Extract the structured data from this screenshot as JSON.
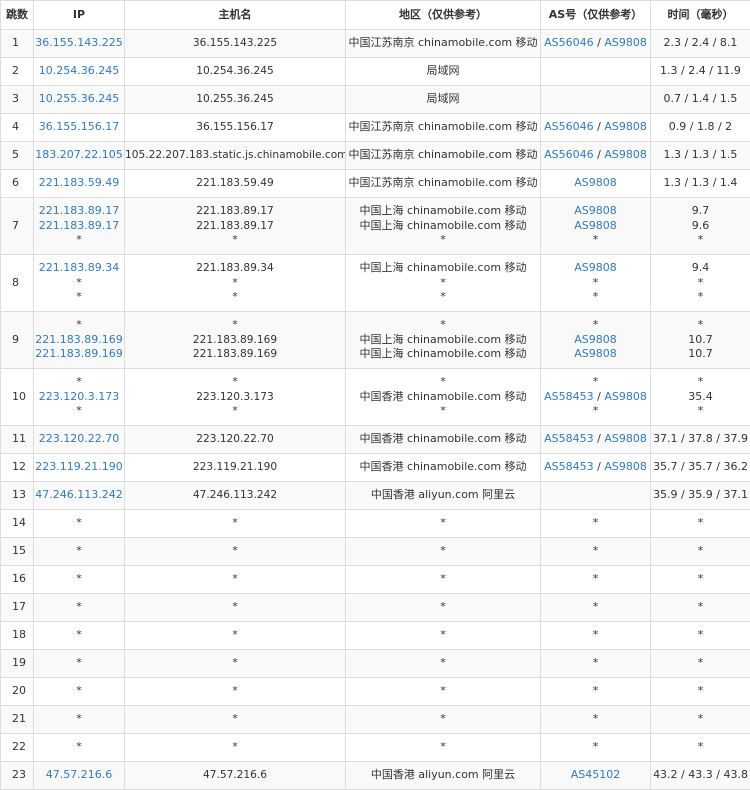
{
  "headers": {
    "hop": "跳数",
    "ip": "IP",
    "host": "主机名",
    "region": "地区（仅供参考）",
    "as": "AS号（仅供参考）",
    "time": "时间（毫秒）"
  },
  "rows": [
    {
      "hop": "1",
      "lines": [
        {
          "ip": "36.155.143.225",
          "host": "36.155.143.225",
          "region": "中国江苏南京 chinamobile.com 移动",
          "as": [
            "AS56046",
            "AS9808"
          ],
          "time": "2.3 / 2.4 / 8.1"
        }
      ]
    },
    {
      "hop": "2",
      "lines": [
        {
          "ip": "10.254.36.245",
          "host": "10.254.36.245",
          "region": "局域网",
          "as": [],
          "time": "1.3 / 2.4 / 11.9"
        }
      ]
    },
    {
      "hop": "3",
      "lines": [
        {
          "ip": "10.255.36.245",
          "host": "10.255.36.245",
          "region": "局域网",
          "as": [],
          "time": "0.7 / 1.4 / 1.5"
        }
      ]
    },
    {
      "hop": "4",
      "lines": [
        {
          "ip": "36.155.156.17",
          "host": "36.155.156.17",
          "region": "中国江苏南京 chinamobile.com 移动",
          "as": [
            "AS56046",
            "AS9808"
          ],
          "time": "0.9 / 1.8 / 2"
        }
      ]
    },
    {
      "hop": "5",
      "lines": [
        {
          "ip": "183.207.22.105",
          "host": "105.22.207.183.static.js.chinamobile.com",
          "region": "中国江苏南京 chinamobile.com 移动",
          "as": [
            "AS56046",
            "AS9808"
          ],
          "time": "1.3 / 1.3 / 1.5"
        }
      ]
    },
    {
      "hop": "6",
      "lines": [
        {
          "ip": "221.183.59.49",
          "host": "221.183.59.49",
          "region": "中国江苏南京 chinamobile.com 移动",
          "as": [
            "AS9808"
          ],
          "time": "1.3 / 1.3 / 1.4"
        }
      ]
    },
    {
      "hop": "7",
      "lines": [
        {
          "ip": "221.183.89.17",
          "host": "221.183.89.17",
          "region": "中国上海 chinamobile.com 移动",
          "as": [
            "AS9808"
          ],
          "time": "9.7"
        },
        {
          "ip": "221.183.89.17",
          "host": "221.183.89.17",
          "region": "中国上海 chinamobile.com 移动",
          "as": [
            "AS9808"
          ],
          "time": "9.6"
        },
        {
          "ip": "*",
          "host": "*",
          "region": "*",
          "as": [
            "*"
          ],
          "time": "*"
        }
      ]
    },
    {
      "hop": "8",
      "lines": [
        {
          "ip": "221.183.89.34",
          "host": "221.183.89.34",
          "region": "中国上海 chinamobile.com 移动",
          "as": [
            "AS9808"
          ],
          "time": "9.4"
        },
        {
          "ip": "*",
          "host": "*",
          "region": "*",
          "as": [
            "*"
          ],
          "time": "*"
        },
        {
          "ip": "*",
          "host": "*",
          "region": "*",
          "as": [
            "*"
          ],
          "time": "*"
        }
      ]
    },
    {
      "hop": "9",
      "lines": [
        {
          "ip": "*",
          "host": "*",
          "region": "*",
          "as": [
            "*"
          ],
          "time": "*"
        },
        {
          "ip": "221.183.89.169",
          "host": "221.183.89.169",
          "region": "中国上海 chinamobile.com 移动",
          "as": [
            "AS9808"
          ],
          "time": "10.7"
        },
        {
          "ip": "221.183.89.169",
          "host": "221.183.89.169",
          "region": "中国上海 chinamobile.com 移动",
          "as": [
            "AS9808"
          ],
          "time": "10.7"
        }
      ]
    },
    {
      "hop": "10",
      "lines": [
        {
          "ip": "*",
          "host": "*",
          "region": "*",
          "as": [
            "*"
          ],
          "time": "*"
        },
        {
          "ip": "223.120.3.173",
          "host": "223.120.3.173",
          "region": "中国香港 chinamobile.com 移动",
          "as": [
            "AS58453",
            "AS9808"
          ],
          "time": "35.4"
        },
        {
          "ip": "*",
          "host": "*",
          "region": "*",
          "as": [
            "*"
          ],
          "time": "*"
        }
      ]
    },
    {
      "hop": "11",
      "lines": [
        {
          "ip": "223.120.22.70",
          "host": "223.120.22.70",
          "region": "中国香港 chinamobile.com 移动",
          "as": [
            "AS58453",
            "AS9808"
          ],
          "time": "37.1 / 37.8 / 37.9"
        }
      ]
    },
    {
      "hop": "12",
      "lines": [
        {
          "ip": "223.119.21.190",
          "host": "223.119.21.190",
          "region": "中国香港 chinamobile.com 移动",
          "as": [
            "AS58453",
            "AS9808"
          ],
          "time": "35.7 / 35.7 / 36.2"
        }
      ]
    },
    {
      "hop": "13",
      "lines": [
        {
          "ip": "47.246.113.242",
          "host": "47.246.113.242",
          "region": "中国香港 aliyun.com 阿里云",
          "as": [],
          "time": "35.9 / 35.9 / 37.1"
        }
      ]
    },
    {
      "hop": "14",
      "lines": [
        {
          "ip": "*",
          "host": "*",
          "region": "*",
          "as": [
            "*"
          ],
          "time": "*"
        }
      ]
    },
    {
      "hop": "15",
      "lines": [
        {
          "ip": "*",
          "host": "*",
          "region": "*",
          "as": [
            "*"
          ],
          "time": "*"
        }
      ]
    },
    {
      "hop": "16",
      "lines": [
        {
          "ip": "*",
          "host": "*",
          "region": "*",
          "as": [
            "*"
          ],
          "time": "*"
        }
      ]
    },
    {
      "hop": "17",
      "lines": [
        {
          "ip": "*",
          "host": "*",
          "region": "*",
          "as": [
            "*"
          ],
          "time": "*"
        }
      ]
    },
    {
      "hop": "18",
      "lines": [
        {
          "ip": "*",
          "host": "*",
          "region": "*",
          "as": [
            "*"
          ],
          "time": "*"
        }
      ]
    },
    {
      "hop": "19",
      "lines": [
        {
          "ip": "*",
          "host": "*",
          "region": "*",
          "as": [
            "*"
          ],
          "time": "*"
        }
      ]
    },
    {
      "hop": "20",
      "lines": [
        {
          "ip": "*",
          "host": "*",
          "region": "*",
          "as": [
            "*"
          ],
          "time": "*"
        }
      ]
    },
    {
      "hop": "21",
      "lines": [
        {
          "ip": "*",
          "host": "*",
          "region": "*",
          "as": [
            "*"
          ],
          "time": "*"
        }
      ]
    },
    {
      "hop": "22",
      "lines": [
        {
          "ip": "*",
          "host": "*",
          "region": "*",
          "as": [
            "*"
          ],
          "time": "*"
        }
      ]
    },
    {
      "hop": "23",
      "lines": [
        {
          "ip": "47.57.216.6",
          "host": "47.57.216.6",
          "region": "中国香港 aliyun.com 阿里云",
          "as": [
            "AS45102"
          ],
          "time": "43.2 / 43.3 / 43.8"
        }
      ]
    }
  ],
  "colors": {
    "link": "#337ab7",
    "border": "#dddddd",
    "stripe": "#f9f9f9",
    "text": "#333333"
  }
}
